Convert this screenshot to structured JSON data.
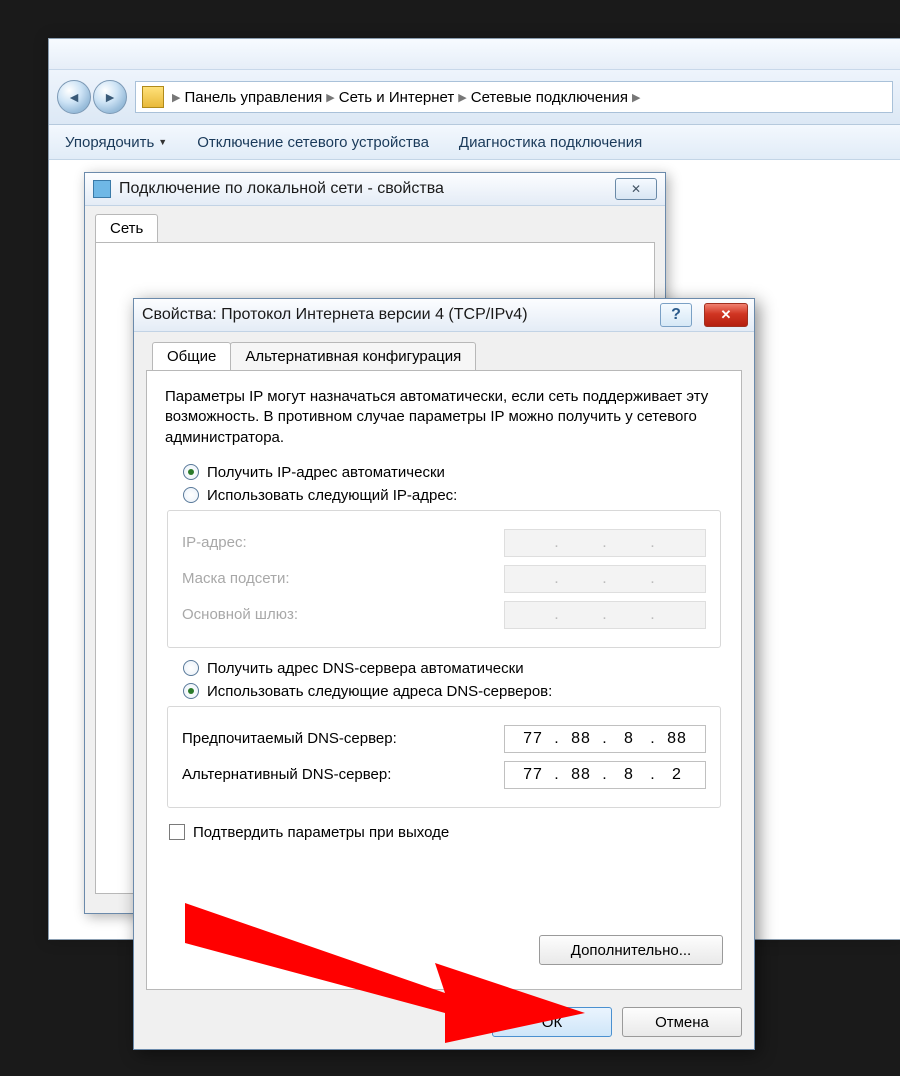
{
  "explorer": {
    "breadcrumb": [
      "Панель управления",
      "Сеть и Интернет",
      "Сетевые подключения"
    ],
    "toolbar": {
      "organize": "Упорядочить",
      "disable": "Отключение сетевого устройства",
      "diagnose": "Диагностика подключения"
    }
  },
  "props": {
    "title": "Подключение по локальной сети - свойства",
    "tab_network": "Сеть"
  },
  "ipv4": {
    "title": "Свойства: Протокол Интернета версии 4 (TCP/IPv4)",
    "tab_general": "Общие",
    "tab_alt": "Альтернативная конфигурация",
    "desc": "Параметры IP могут назначаться автоматически, если сеть поддерживает эту возможность. В противном случае параметры IP можно получить у сетевого администратора.",
    "radio_ip_auto": "Получить IP-адрес автоматически",
    "radio_ip_manual": "Использовать следующий IP-адрес:",
    "label_ip": "IP-адрес:",
    "label_mask": "Маска подсети:",
    "label_gateway": "Основной шлюз:",
    "radio_dns_auto": "Получить адрес DNS-сервера автоматически",
    "radio_dns_manual": "Использовать следующие адреса DNS-серверов:",
    "label_dns_pref": "Предпочитаемый DNS-сервер:",
    "label_dns_alt": "Альтернативный DNS-сервер:",
    "dns_pref": [
      "77",
      "88",
      "8",
      "88"
    ],
    "dns_alt": [
      "77",
      "88",
      "8",
      "2"
    ],
    "check_validate": "Подтвердить параметры при выходе",
    "btn_advanced": "Дополнительно...",
    "btn_ok": "ОК",
    "btn_cancel": "Отмена"
  }
}
